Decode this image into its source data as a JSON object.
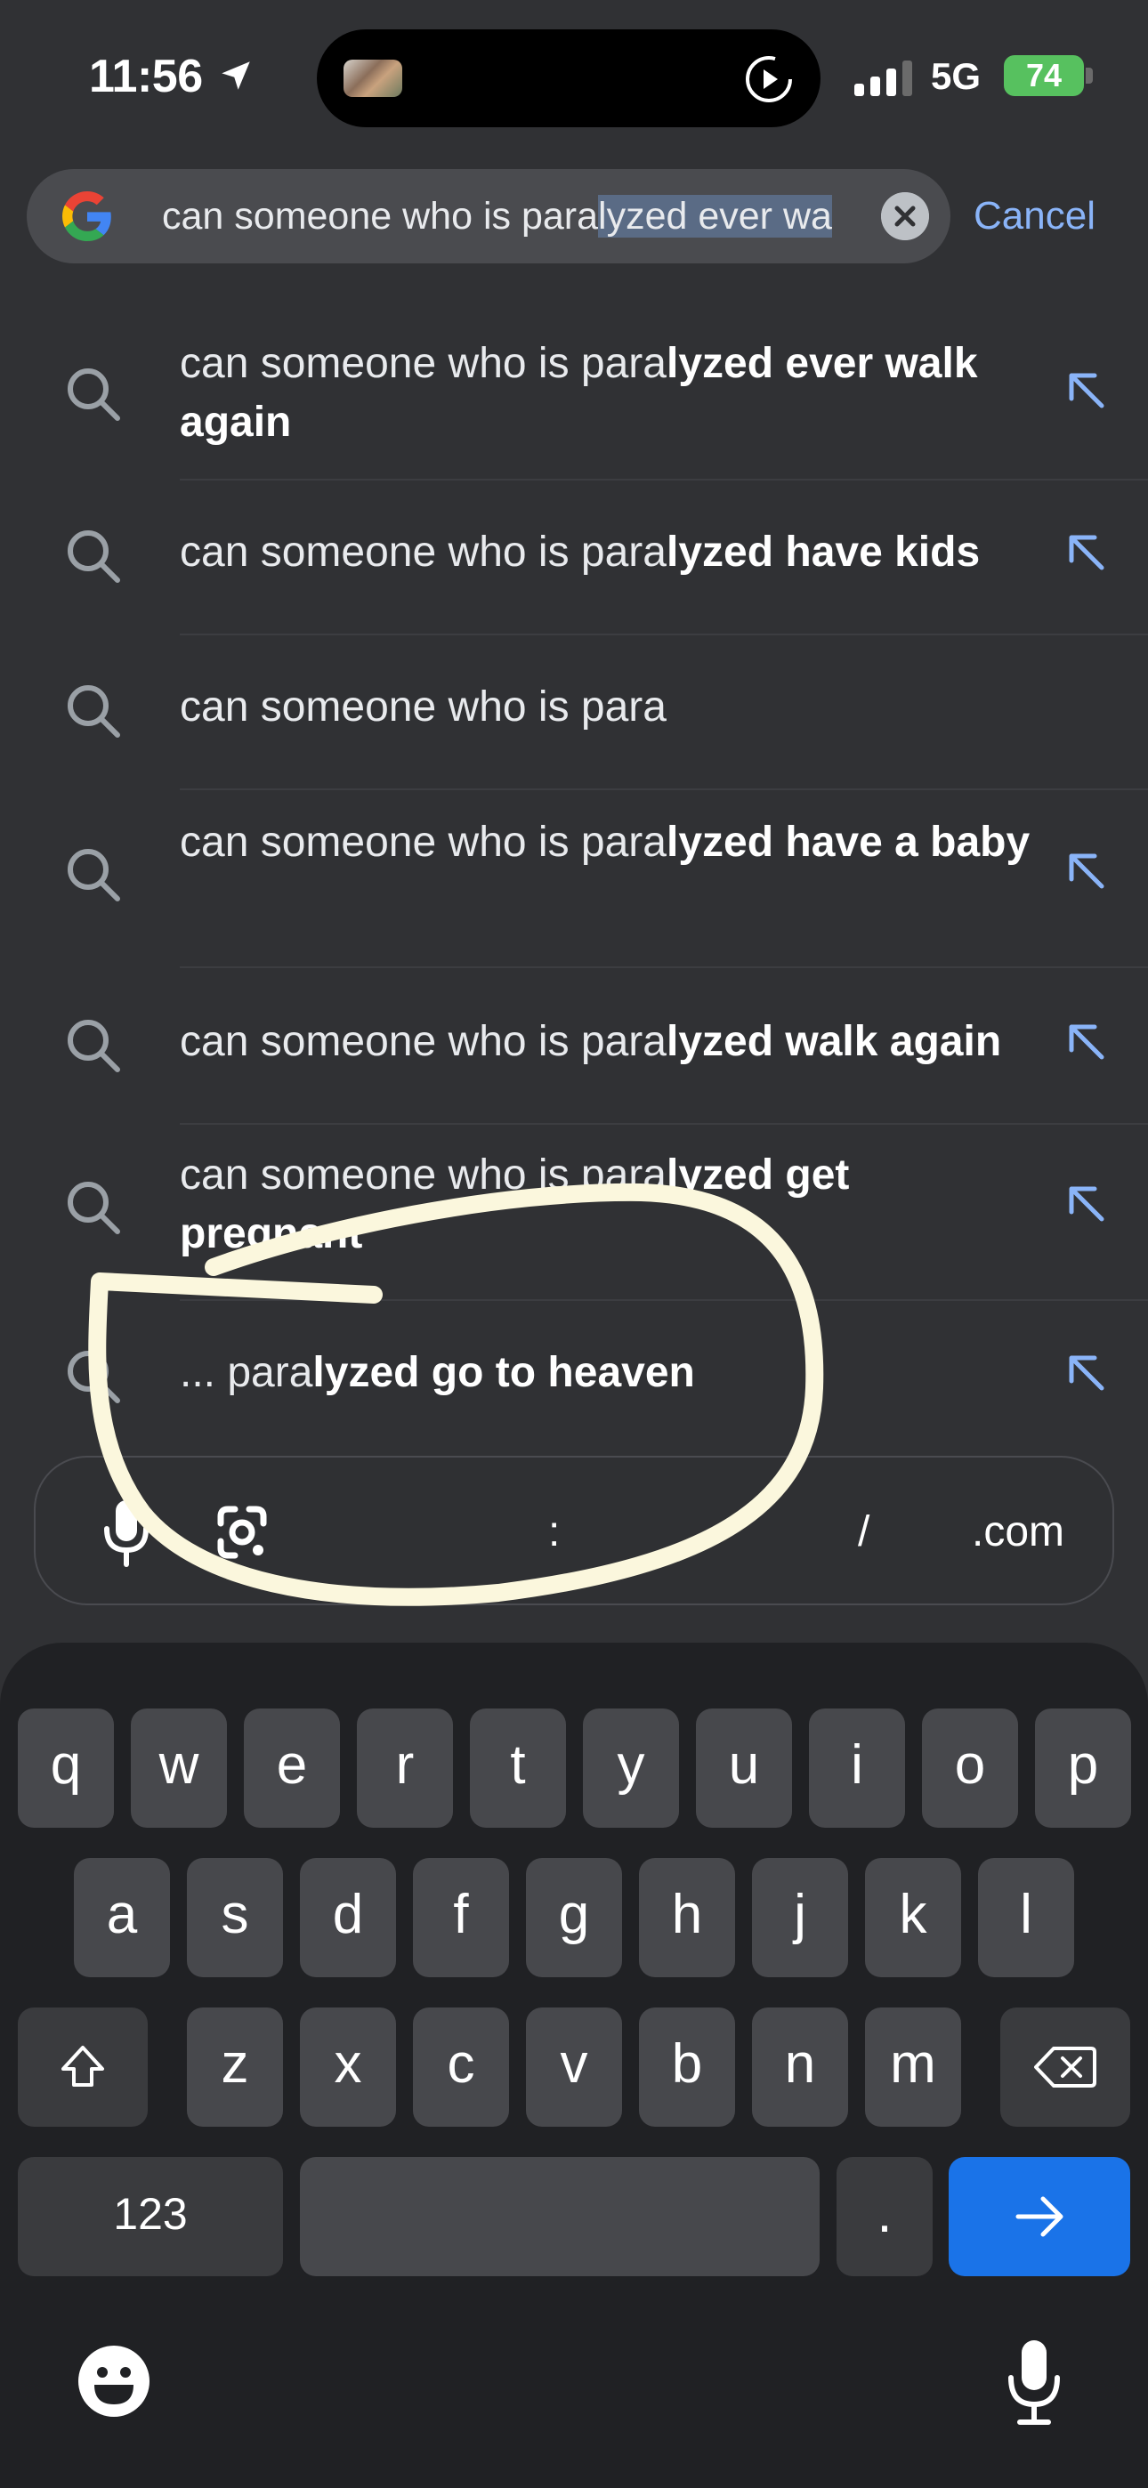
{
  "status_bar": {
    "time": "11:56",
    "network": "5G",
    "battery": "74"
  },
  "search": {
    "query_unselected": "can someone who is para",
    "query_selected": "lyzed ever wa",
    "cancel_label": "Cancel"
  },
  "suggestions": [
    {
      "plain": "can someone who is para",
      "bold": "lyzed ever walk again",
      "has_fill": true
    },
    {
      "plain": "can someone who is para",
      "bold": "lyzed have kids",
      "has_fill": true
    },
    {
      "plain": "can someone who is para",
      "bold": "",
      "has_fill": false
    },
    {
      "plain": "can someone who is para",
      "bold": "lyzed have a baby",
      "has_fill": true
    },
    {
      "plain": "can someone who is para",
      "bold": "lyzed walk again",
      "has_fill": true
    },
    {
      "plain": "can someone who is para",
      "bold": "lyzed get pregnant",
      "has_fill": true
    },
    {
      "plain": "... para",
      "bold": "lyzed go to heaven",
      "has_fill": true
    }
  ],
  "accessory_bar": {
    "keys": [
      ":",
      "-",
      "/",
      ".com"
    ]
  },
  "keyboard": {
    "row1": [
      "q",
      "w",
      "e",
      "r",
      "t",
      "y",
      "u",
      "i",
      "o",
      "p"
    ],
    "row2": [
      "a",
      "s",
      "d",
      "f",
      "g",
      "h",
      "j",
      "k",
      "l"
    ],
    "row3": [
      "z",
      "x",
      "c",
      "v",
      "b",
      "n",
      "m"
    ],
    "numbers_label": "123",
    "period_label": ".",
    "go_label": "→"
  },
  "icons": {
    "location": "location-arrow-icon",
    "play": "play-circle-icon",
    "signal": "cellular-signal-icon",
    "google": "google-g-logo",
    "clear": "clear-x-icon",
    "search": "search-icon",
    "fill": "arrow-up-left-icon",
    "mic": "mic-icon",
    "lens": "google-lens-icon",
    "shift": "shift-icon",
    "backspace": "backspace-icon",
    "emoji": "emoji-icon",
    "dictation": "dictation-mic-icon"
  },
  "colors": {
    "background": "#303134",
    "link": "#8ab4f8",
    "go_key": "#1a73e8",
    "battery": "#57c15f",
    "annotation": "#fbf7dd"
  }
}
